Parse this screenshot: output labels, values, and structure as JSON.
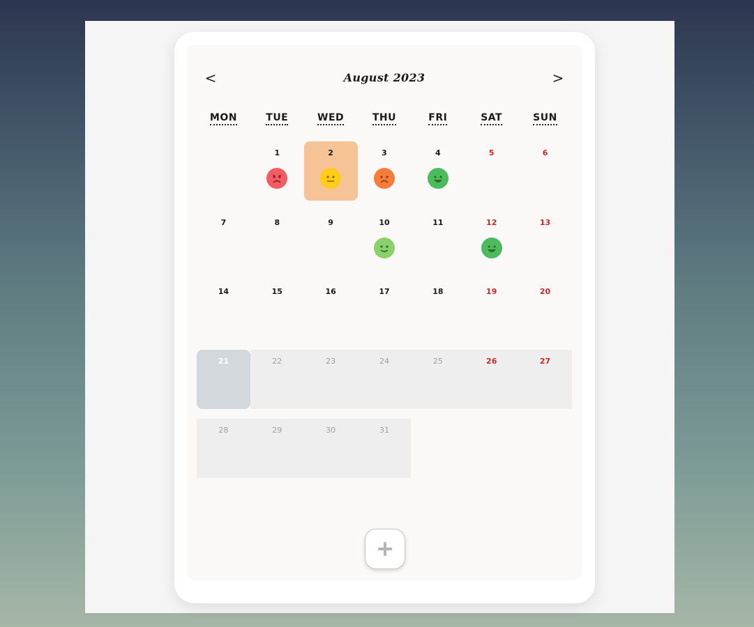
{
  "calendar": {
    "title": "August 2023",
    "prev_label": "<",
    "next_label": ">",
    "weekdays": [
      "MON",
      "TUE",
      "WED",
      "THU",
      "FRI",
      "SAT",
      "SUN"
    ],
    "days": [
      {
        "day": "1",
        "col": 1,
        "row": 0,
        "mood": "very-sad",
        "mood_color": "#f25c62",
        "weekend": false
      },
      {
        "day": "2",
        "col": 2,
        "row": 0,
        "mood": "neutral",
        "mood_color": "#ffcc1a",
        "weekend": false,
        "selected": true
      },
      {
        "day": "3",
        "col": 3,
        "row": 0,
        "mood": "sad",
        "mood_color": "#f57d3c",
        "weekend": false
      },
      {
        "day": "4",
        "col": 4,
        "row": 0,
        "mood": "very-happy",
        "mood_color": "#4cbb5c",
        "weekend": false
      },
      {
        "day": "5",
        "col": 5,
        "row": 0,
        "weekend": true
      },
      {
        "day": "6",
        "col": 6,
        "row": 0,
        "weekend": true
      },
      {
        "day": "7",
        "col": 0,
        "row": 1,
        "weekend": false
      },
      {
        "day": "8",
        "col": 1,
        "row": 1,
        "weekend": false
      },
      {
        "day": "9",
        "col": 2,
        "row": 1,
        "weekend": false
      },
      {
        "day": "10",
        "col": 3,
        "row": 1,
        "mood": "happy",
        "mood_color": "#8ad16a",
        "weekend": false
      },
      {
        "day": "11",
        "col": 4,
        "row": 1,
        "weekend": false
      },
      {
        "day": "12",
        "col": 5,
        "row": 1,
        "mood": "very-happy",
        "mood_color": "#4cbb5c",
        "weekend": true
      },
      {
        "day": "13",
        "col": 6,
        "row": 1,
        "weekend": true
      },
      {
        "day": "14",
        "col": 0,
        "row": 2,
        "weekend": false
      },
      {
        "day": "15",
        "col": 1,
        "row": 2,
        "weekend": false
      },
      {
        "day": "16",
        "col": 2,
        "row": 2,
        "weekend": false
      },
      {
        "day": "17",
        "col": 3,
        "row": 2,
        "weekend": false
      },
      {
        "day": "18",
        "col": 4,
        "row": 2,
        "weekend": false
      },
      {
        "day": "19",
        "col": 5,
        "row": 2,
        "weekend": true
      },
      {
        "day": "20",
        "col": 6,
        "row": 2,
        "weekend": true
      },
      {
        "day": "21",
        "col": 0,
        "row": 3,
        "weekend": false,
        "today": true
      },
      {
        "day": "22",
        "col": 1,
        "row": 3,
        "weekend": false,
        "future": true
      },
      {
        "day": "23",
        "col": 2,
        "row": 3,
        "weekend": false,
        "future": true
      },
      {
        "day": "24",
        "col": 3,
        "row": 3,
        "weekend": false,
        "future": true
      },
      {
        "day": "25",
        "col": 4,
        "row": 3,
        "weekend": false,
        "future": true
      },
      {
        "day": "26",
        "col": 5,
        "row": 3,
        "weekend": true,
        "future": true
      },
      {
        "day": "27",
        "col": 6,
        "row": 3,
        "weekend": true,
        "future": true
      },
      {
        "day": "28",
        "col": 0,
        "row": 4,
        "weekend": false,
        "future": true
      },
      {
        "day": "29",
        "col": 1,
        "row": 4,
        "weekend": false,
        "future": true
      },
      {
        "day": "30",
        "col": 2,
        "row": 4,
        "weekend": false,
        "future": true
      },
      {
        "day": "31",
        "col": 3,
        "row": 4,
        "weekend": false,
        "future": true
      }
    ],
    "add_button_icon": "plus-icon"
  },
  "colors": {
    "selected": "#f5c396",
    "today": "#d2d8dc",
    "weekend_text": "#c62828",
    "future_cell": "#eeeeee"
  }
}
